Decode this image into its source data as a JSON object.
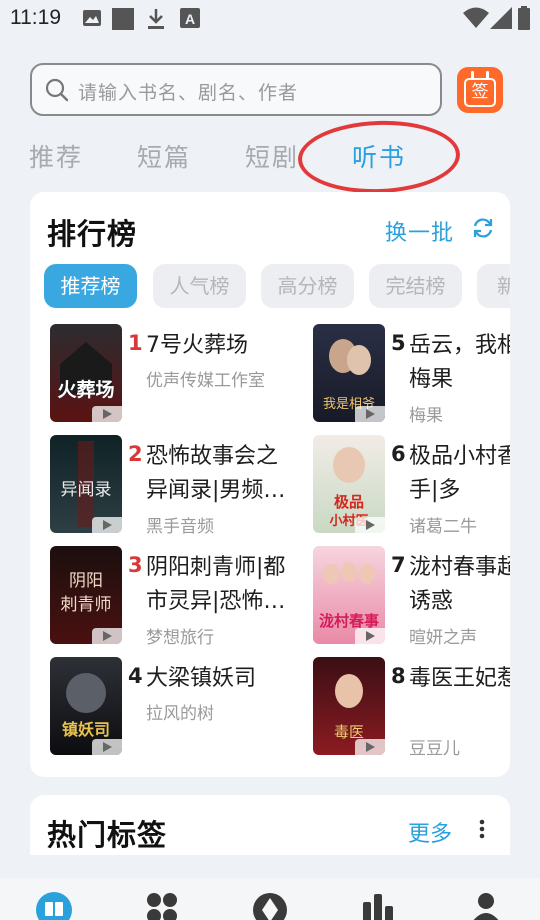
{
  "status_bar": {
    "time": "11:19",
    "left_icons": [
      "image-icon",
      "square-icon",
      "download-icon",
      "font-icon"
    ],
    "right_icons": [
      "wifi-icon",
      "signal-icon",
      "battery-icon"
    ]
  },
  "search": {
    "placeholder": "请输入书名、剧名、作者",
    "sign_label": "签"
  },
  "tabs": [
    {
      "label": "推荐",
      "active": false
    },
    {
      "label": "短篇",
      "active": false
    },
    {
      "label": "短剧",
      "active": false
    },
    {
      "label": "听书",
      "active": true
    }
  ],
  "ranking": {
    "title": "排行榜",
    "refresh_label": "换一批",
    "chips": [
      {
        "label": "推荐榜",
        "active": true
      },
      {
        "label": "人气榜",
        "active": false
      },
      {
        "label": "高分榜",
        "active": false
      },
      {
        "label": "完结榜",
        "active": false
      },
      {
        "label": "新",
        "active": false
      }
    ],
    "books": [
      {
        "rank": "1",
        "title": "7号火葬场",
        "author": "优声传媒工作室"
      },
      {
        "rank": "2",
        "title": "恐怖故事会之异闻录|男频…",
        "author": "黑手音频"
      },
      {
        "rank": "3",
        "title": "阴阳刺青师|都市灵异|恐怖…",
        "author": "梦想旅行"
      },
      {
        "rank": "4",
        "title": "大梁镇妖司",
        "author": "拉风的树"
      },
      {
        "rank": "5",
        "title": "岳云，我相爷|梅果",
        "author": "梅果"
      },
      {
        "rank": "6",
        "title": "极品小村香高手|多",
        "author": "诸葛二牛"
      },
      {
        "rank": "7",
        "title": "泷村春事超级诱惑",
        "author": "暄妍之声"
      },
      {
        "rank": "8",
        "title": "毒医王妃惹",
        "author": "豆豆儿"
      }
    ]
  },
  "hot_tags": {
    "title": "热门标签",
    "more_label": "更多"
  },
  "bottom_nav": {
    "items": [
      "book-icon",
      "grid-icon",
      "compass-icon",
      "chart-icon",
      "profile-icon"
    ]
  },
  "colors": {
    "accent": "#2aa0dc",
    "rank_top": "#d9383a",
    "rank_other": "#1e1e1e",
    "annotation": "#e23a3a"
  }
}
